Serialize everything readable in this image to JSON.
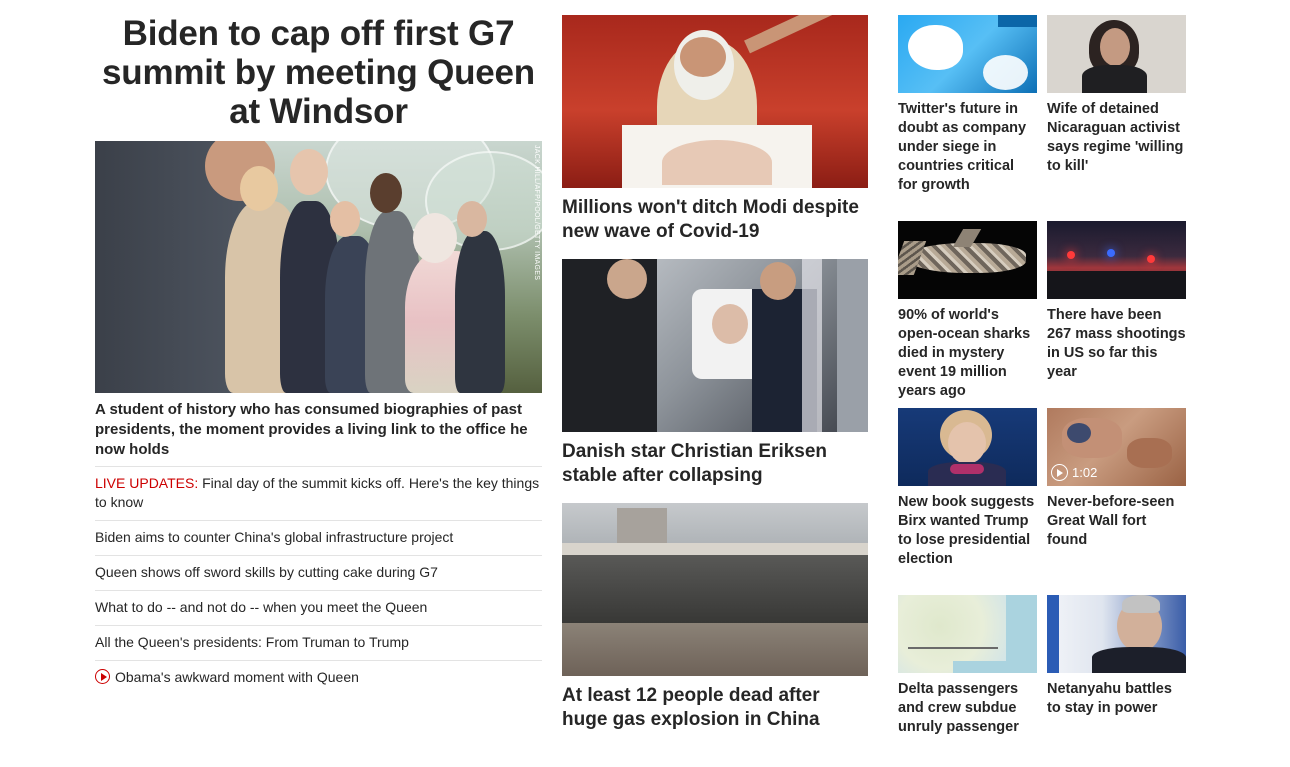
{
  "lead": {
    "headline": "Biden to cap off first G7 summit by meeting Queen at Windsor",
    "image_credit": "JACK HILL/AFP/POOL/GETTY IMAGES",
    "caption": "A student of history who has consumed biographies of past presidents, the moment provides a living link to the office he now holds",
    "related": [
      {
        "prefix": "LIVE UPDATES:",
        "text": " Final day of the summit kicks off. Here's the key things to know"
      },
      {
        "prefix": "",
        "text": "Biden aims to counter China's global infrastructure project"
      },
      {
        "prefix": "",
        "text": "Queen shows off sword skills by cutting cake during G7"
      },
      {
        "prefix": "",
        "text": "What to do -- and not do -- when you meet the Queen"
      },
      {
        "prefix": "",
        "text": "All the Queen's presidents: From Truman to Trump"
      },
      {
        "prefix": "",
        "text": "Obama's awkward moment with Queen",
        "icon": "play-circle-icon"
      }
    ]
  },
  "middle": [
    {
      "title": "Millions won't ditch Modi despite new wave of Covid-19"
    },
    {
      "title": "Danish star Christian Eriksen stable after collapsing"
    },
    {
      "title": "At least 12 people dead after huge gas explosion in China"
    }
  ],
  "grid": [
    {
      "title": "Twitter's future in doubt as company under siege in countries critical for growth"
    },
    {
      "title": "Wife of detained Nicaraguan activist says regime 'willing to kill'"
    },
    {
      "title": "90% of world's open-ocean sharks died in mystery event 19 million years ago"
    },
    {
      "title": "There have been 267 mass shootings in US so far this year"
    },
    {
      "title": "New book suggests Birx wanted Trump to lose presidential election"
    },
    {
      "title": "Never-before-seen Great Wall fort found",
      "video_duration": "1:02"
    },
    {
      "title": "Delta passengers and crew subdue unruly passenger"
    },
    {
      "title": "Netanyahu battles to stay in power"
    }
  ],
  "colors": {
    "text": "#262626",
    "live_red": "#cc0000",
    "divider": "#e3e3e3"
  }
}
